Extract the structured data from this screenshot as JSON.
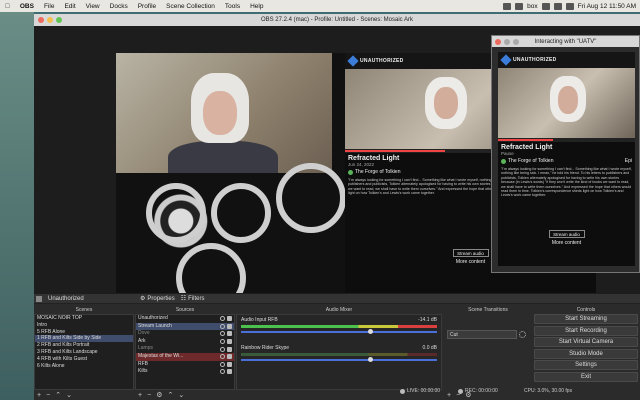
{
  "menubar": {
    "items": [
      "OBS",
      "File",
      "Edit",
      "View",
      "Docks",
      "Profile",
      "Scene Collection",
      "Tools",
      "Help"
    ],
    "box_label": "box",
    "clock": "Fri Aug 12  11:50 AM"
  },
  "window": {
    "title": "OBS 27.2.4 (mac) - Profile: Untitled - Scenes: Mosaic Ark"
  },
  "preview": {
    "brand": "UNAUTHORIZED",
    "video_title": "Refracted Light",
    "video_meta": "Jun 24, 2022",
    "episode_label": "The Forge of Tolkien",
    "episode_extra": "Epi",
    "body_text": "\"I'm always looking for something I can't find... Something like what I wrote myself, nothing like being sick. I mean,\" he told his friend. To his letters to publishers and publicists, Tolkien alternately apologised for having to write his own stories because (in Lewis's words) \"if they won't write the kind of books we want to read, we shall have to write them ourselves.\" And expressed the hope that others would read them in time. Tolkien's correspondence sheds light on how Tolkien's and Lewis's work came together.",
    "stream_btn": "Stream audio",
    "more": "More content"
  },
  "popup": {
    "title": "Interacting with \"UATV\"",
    "episode_status": "Pause",
    "stream_btn": "Stream audio",
    "more": "More content"
  },
  "source_bar": {
    "scene_name": "Unauthorized",
    "properties": "Properties",
    "filters": "Filters"
  },
  "docks": {
    "scenes_label": "Scenes",
    "sources_label": "Sources",
    "mixer_label": "Audio Mixer",
    "transitions_label": "Scene Transitions",
    "controls_label": "Controls"
  },
  "scenes": [
    "MOSAIC NOIR TOP",
    "Intro",
    "5 RFB Alone",
    "1 RFB and Kilts Side by Side",
    "2 RFB and Kilts Portrait",
    "3 RFB and Kilts Landscape",
    "4 RFB with Kilts Guest",
    "6 Kilts Alone"
  ],
  "scene_selected_index": 3,
  "sources": [
    {
      "name": "Unauthorized",
      "state": "normal"
    },
    {
      "name": "Stream Launch",
      "state": "selected"
    },
    {
      "name": "Dove",
      "state": "dim"
    },
    {
      "name": "Ark",
      "state": "normal"
    },
    {
      "name": "Lamps",
      "state": "dim"
    },
    {
      "name": "Majestas of the Wi...",
      "state": "highlight"
    },
    {
      "name": "RFB",
      "state": "normal"
    },
    {
      "name": "Kilts",
      "state": "normal"
    }
  ],
  "mixer": [
    {
      "name": "Audio Input RFB",
      "level": "-14.1 dB",
      "volume": 0.65,
      "live": true
    },
    {
      "name": "Rainbow Rider Skype",
      "level": "0.0 dB",
      "volume": 0.65,
      "live": false
    }
  ],
  "transition": {
    "value": "Cut"
  },
  "controls": [
    "Start Streaming",
    "Start Recording",
    "Start Virtual Camera",
    "Studio Mode",
    "Settings",
    "Exit"
  ],
  "status": {
    "live": "LIVE: 00:00:00",
    "rec": "REC: 00:00:00",
    "cpu": "CPU: 3.0%, 30.00 fps"
  },
  "colors": {
    "selection": "#3f4c6b",
    "highlight": "#6e2a2a",
    "desktop": "#3f6b73"
  }
}
